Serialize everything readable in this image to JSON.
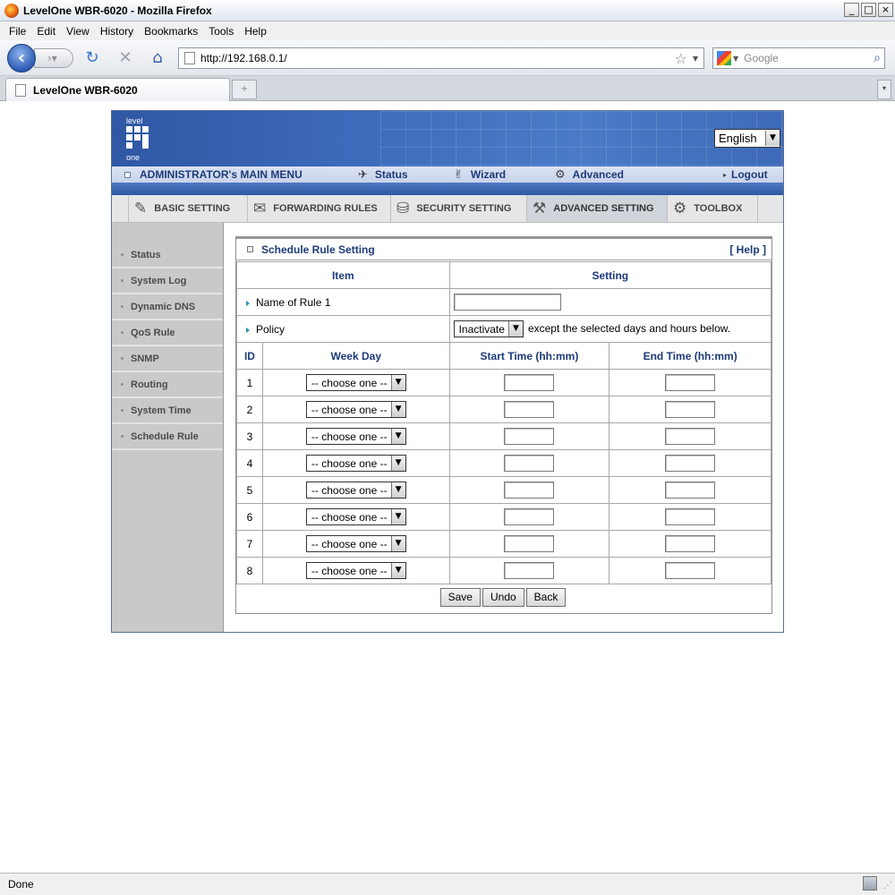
{
  "window": {
    "title": "LevelOne WBR-6020 - Mozilla Firefox",
    "controls": [
      "_",
      "□",
      "×"
    ]
  },
  "menubar": [
    "File",
    "Edit",
    "View",
    "History",
    "Bookmarks",
    "Tools",
    "Help"
  ],
  "navbar": {
    "url": "http://192.168.0.1/",
    "search_placeholder": "Google"
  },
  "tabs": [
    {
      "title": "LevelOne WBR-6020"
    }
  ],
  "statusbar": {
    "text": "Done"
  },
  "router": {
    "logo": {
      "top": "level",
      "bottom": "one"
    },
    "language": "English",
    "main_menu": {
      "title": "ADMINISTRATOR's MAIN MENU",
      "status": "Status",
      "wizard": "Wizard",
      "advanced": "Advanced",
      "logout": "Logout"
    },
    "subnav": [
      {
        "label": "BASIC SETTING",
        "active": false
      },
      {
        "label": "FORWARDING RULES",
        "active": false
      },
      {
        "label": "SECURITY SETTING",
        "active": false
      },
      {
        "label": "ADVANCED SETTING",
        "active": true
      },
      {
        "label": "TOOLBOX",
        "active": false
      }
    ],
    "sidebar": [
      "Status",
      "System Log",
      "Dynamic DNS",
      "QoS Rule",
      "SNMP",
      "Routing",
      "System Time",
      "Schedule Rule"
    ],
    "panel": {
      "title": "Schedule Rule Setting",
      "help": "[ Help ]",
      "col_item": "Item",
      "col_setting": "Setting",
      "name_label": "Name of Rule 1",
      "name_value": "",
      "policy_label": "Policy",
      "policy_value": "Inactivate",
      "policy_note": "except the selected days and hours below.",
      "col_id": "ID",
      "col_weekday": "Week Day",
      "col_start": "Start Time (hh:mm)",
      "col_end": "End Time (hh:mm)",
      "rows": [
        {
          "id": "1",
          "weekday": "-- choose one --",
          "start": "",
          "end": ""
        },
        {
          "id": "2",
          "weekday": "-- choose one --",
          "start": "",
          "end": ""
        },
        {
          "id": "3",
          "weekday": "-- choose one --",
          "start": "",
          "end": ""
        },
        {
          "id": "4",
          "weekday": "-- choose one --",
          "start": "",
          "end": ""
        },
        {
          "id": "5",
          "weekday": "-- choose one --",
          "start": "",
          "end": ""
        },
        {
          "id": "6",
          "weekday": "-- choose one --",
          "start": "",
          "end": ""
        },
        {
          "id": "7",
          "weekday": "-- choose one --",
          "start": "",
          "end": ""
        },
        {
          "id": "8",
          "weekday": "-- choose one --",
          "start": "",
          "end": ""
        }
      ],
      "buttons": {
        "save": "Save",
        "undo": "Undo",
        "back": "Back"
      }
    }
  },
  "colors": {
    "banner": "#3f6dbd",
    "menu_text": "#1d3a7a",
    "sidebar": "#c9c9c9"
  }
}
